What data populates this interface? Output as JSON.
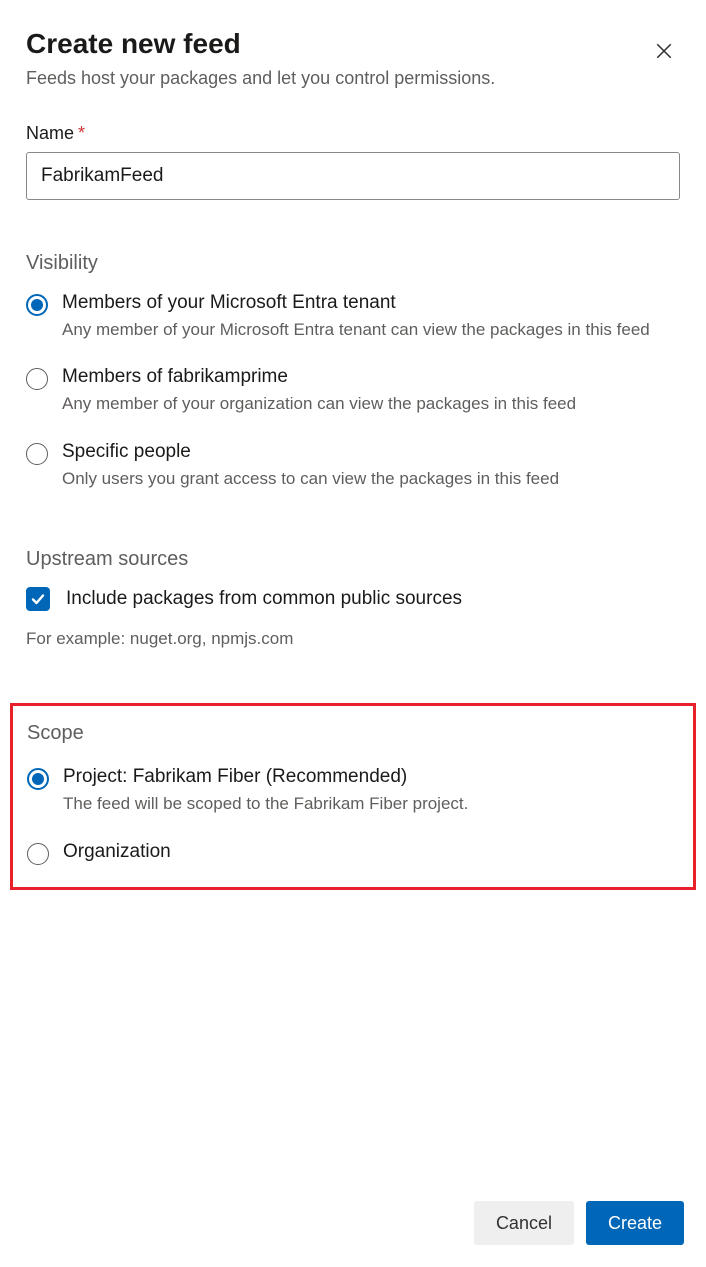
{
  "header": {
    "title": "Create new feed",
    "subtitle": "Feeds host your packages and let you control permissions."
  },
  "name_field": {
    "label": "Name",
    "value": "FabrikamFeed"
  },
  "visibility": {
    "section_label": "Visibility",
    "options": [
      {
        "title": "Members of your Microsoft Entra tenant",
        "desc": "Any member of your Microsoft Entra tenant can view the packages in this feed",
        "selected": true
      },
      {
        "title": "Members of fabrikamprime",
        "desc": "Any member of your organization can view the packages in this feed",
        "selected": false
      },
      {
        "title": "Specific people",
        "desc": "Only users you grant access to can view the packages in this feed",
        "selected": false
      }
    ]
  },
  "upstream": {
    "section_label": "Upstream sources",
    "checkbox_label": "Include packages from common public sources",
    "checked": true,
    "hint": "For example: nuget.org, npmjs.com"
  },
  "scope": {
    "section_label": "Scope",
    "options": [
      {
        "title": "Project: Fabrikam Fiber (Recommended)",
        "desc": "The feed will be scoped to the Fabrikam Fiber project.",
        "selected": true
      },
      {
        "title": "Organization",
        "desc": "",
        "selected": false
      }
    ]
  },
  "buttons": {
    "cancel": "Cancel",
    "create": "Create"
  }
}
